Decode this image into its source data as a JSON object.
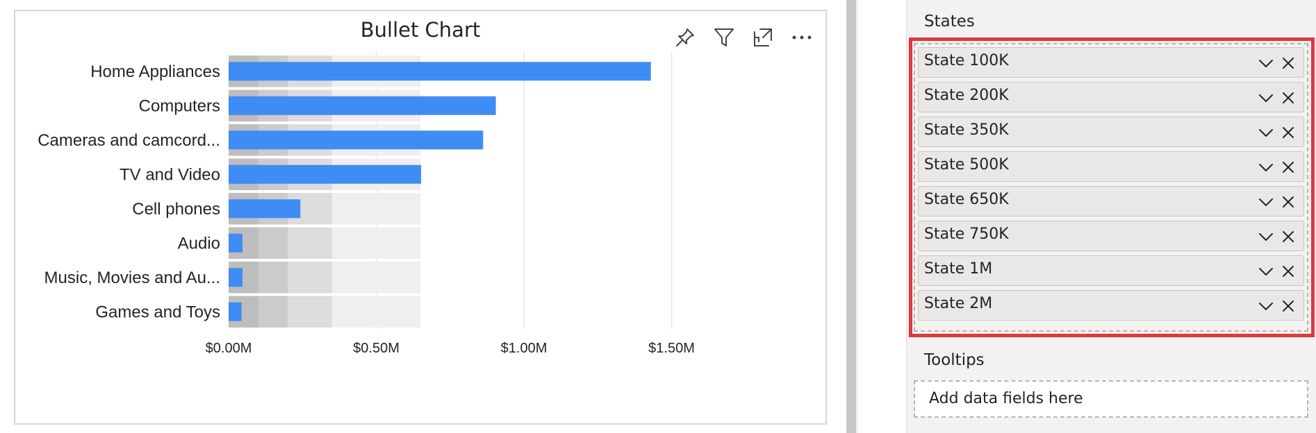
{
  "visual": {
    "title": "Bullet Chart",
    "header_icons": [
      "pin-icon",
      "filter-icon",
      "focus-mode-icon",
      "more-options-icon"
    ]
  },
  "chart_data": {
    "type": "bar",
    "orientation": "horizontal",
    "title": "Bullet Chart",
    "categories": [
      "Home Appliances",
      "Computers",
      "Cameras and camcord...",
      "TV and Video",
      "Cell phones",
      "Audio",
      "Music, Movies and Au...",
      "Games and Toys"
    ],
    "values": [
      1430000,
      905000,
      862000,
      652000,
      243000,
      47000,
      47000,
      44000
    ],
    "bands": [
      100000,
      200000,
      350000,
      650000
    ],
    "band_colors": [
      "#bdbdbd",
      "#cbcbcb",
      "#dcdcdc",
      "#efefef"
    ],
    "bar_color": "#3f8cf5",
    "xlim": [
      0,
      1600000
    ],
    "x_ticks": [
      0,
      500000,
      1000000,
      1500000
    ],
    "x_tick_labels": [
      "$0.00M",
      "$0.50M",
      "$1.00M",
      "$1.50M"
    ],
    "grid": true,
    "xlabel": "",
    "ylabel": ""
  },
  "fields_pane": {
    "states_title": "States",
    "states": [
      "State 100K",
      "State 200K",
      "State 350K",
      "State 500K",
      "State 650K",
      "State 750K",
      "State 1M",
      "State 2M"
    ],
    "highlight_color": "#e0383f",
    "tooltips_title": "Tooltips",
    "tooltips_placeholder": "Add data fields here"
  }
}
